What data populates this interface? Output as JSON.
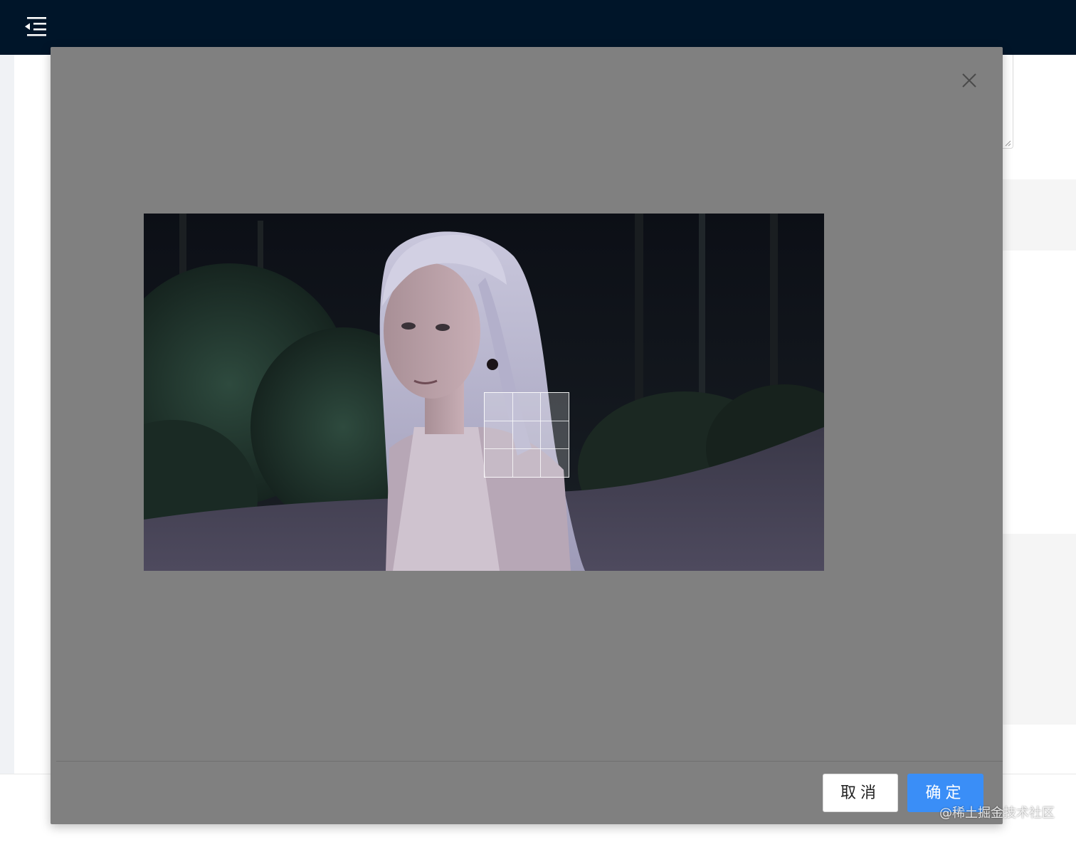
{
  "header": {
    "menu_icon": "menu-fold-icon"
  },
  "modal": {
    "close_icon": "close-icon",
    "cancel_label": "取消",
    "ok_label": "确定"
  },
  "cropper": {
    "image_description_icon": "photo-image",
    "grid_divisions": 3
  },
  "watermark": {
    "text": "@稀土掘金技术社区"
  },
  "colors": {
    "header_bg": "#001529",
    "modal_bg": "#808080",
    "primary": "#3a8ef7"
  }
}
